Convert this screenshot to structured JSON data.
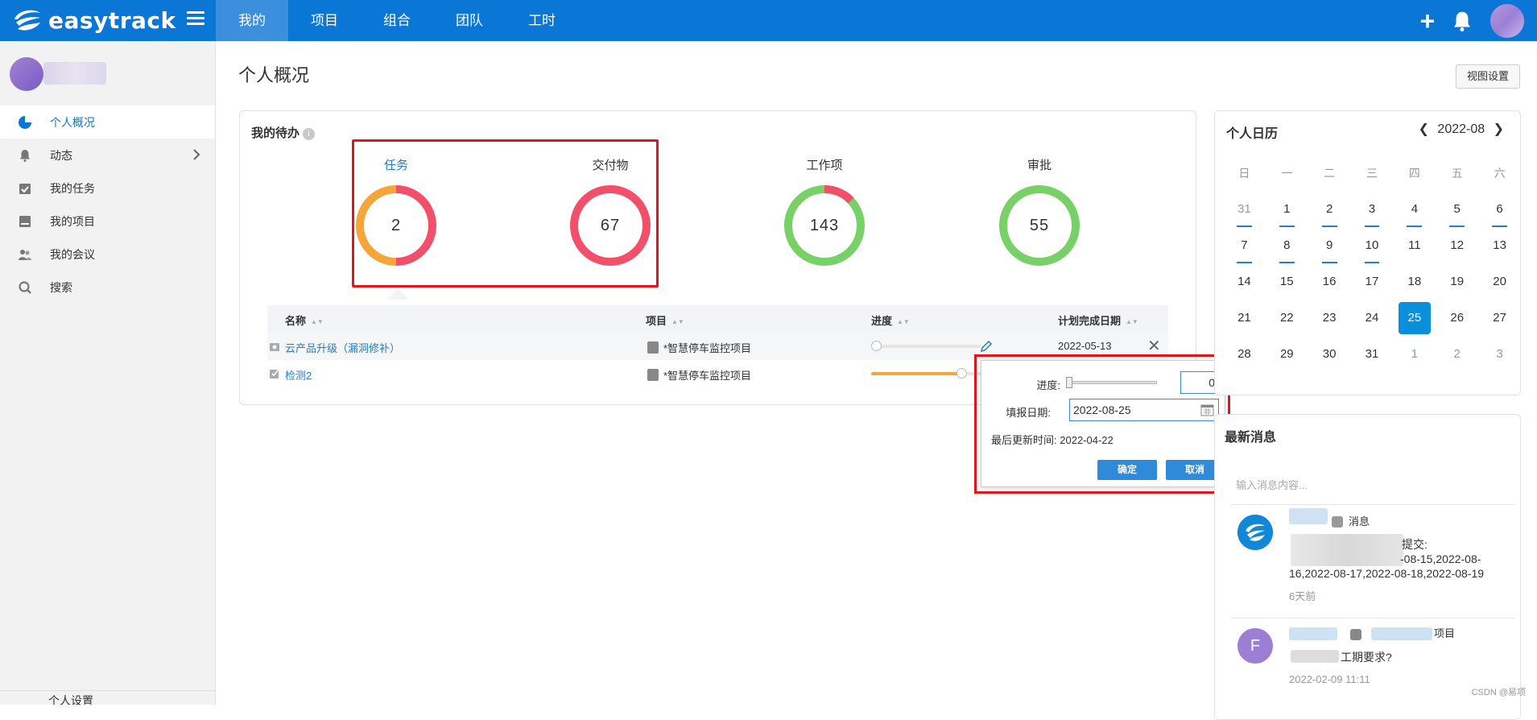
{
  "app": {
    "logo_text": "easytrack"
  },
  "nav": {
    "items": [
      "我的",
      "项目",
      "组合",
      "团队",
      "工时"
    ],
    "active_index": 0
  },
  "sidebar": {
    "items": [
      {
        "label": "个人概况",
        "icon": "pie-chart-icon",
        "active": true
      },
      {
        "label": "动态",
        "icon": "bell-icon"
      },
      {
        "label": "我的任务",
        "icon": "calendar-check-icon"
      },
      {
        "label": "我的项目",
        "icon": "project-icon"
      },
      {
        "label": "我的会议",
        "icon": "people-icon"
      },
      {
        "label": "搜索",
        "icon": "search-icon"
      }
    ],
    "bottom_label": "个人设置"
  },
  "page": {
    "title": "个人概况",
    "view_settings": "视图设置"
  },
  "todo": {
    "title": "我的待办",
    "stats": [
      {
        "label": "任务",
        "value": "2"
      },
      {
        "label": "交付物",
        "value": "67"
      },
      {
        "label": "工作项",
        "value": "143"
      },
      {
        "label": "审批",
        "value": "55"
      }
    ],
    "table": {
      "headers": [
        "名称",
        "项目",
        "进度",
        "计划完成日期"
      ],
      "rows": [
        {
          "name": "云产品升级（漏洞修补）",
          "project": "*智慧停车监控项目",
          "progress": 0,
          "due": "2022-05-13"
        },
        {
          "name": "检测2",
          "project": "*智慧停车监控项目",
          "progress": 0.8,
          "due": ""
        }
      ]
    }
  },
  "popup": {
    "progress_label": "进度:",
    "progress_value": "0",
    "date_label": "填报日期:",
    "date_value": "2022-08-25",
    "updated_label": "最后更新时间:",
    "updated_value": "2022-04-22",
    "ok": "确定",
    "cancel": "取消"
  },
  "calendar": {
    "title": "个人日历",
    "month": "2022-08",
    "weekdays": [
      "日",
      "一",
      "二",
      "三",
      "四",
      "五",
      "六"
    ],
    "weeks": [
      [
        "31",
        "1",
        "2",
        "3",
        "4",
        "5",
        "6"
      ],
      [
        "7",
        "8",
        "9",
        "10",
        "11",
        "12",
        "13"
      ],
      [
        "14",
        "15",
        "16",
        "17",
        "18",
        "19",
        "20"
      ],
      [
        "21",
        "22",
        "23",
        "24",
        "25",
        "26",
        "27"
      ],
      [
        "28",
        "29",
        "30",
        "31",
        "1",
        "2",
        "3"
      ]
    ],
    "selected": "25"
  },
  "messages": {
    "title": "最新消息",
    "input_placeholder": "输入消息内容...",
    "items": [
      {
        "tag": "消息",
        "text_1": "提交:",
        "text_2": "-08-15,2022-08-",
        "text_3": "16,2022-08-17,2022-08-18,2022-08-19",
        "time": "6天前"
      },
      {
        "avatar_letter": "F",
        "tag": "项目",
        "text_1": "工期要求?",
        "time": "2022-02-09 11:11"
      }
    ]
  },
  "watermark": "CSDN @易项",
  "colors": {
    "brand": "#0a77d6",
    "orange": "#f5a53a",
    "red": "#f2506a",
    "green": "#78d167",
    "annotation": "#e5141a"
  }
}
